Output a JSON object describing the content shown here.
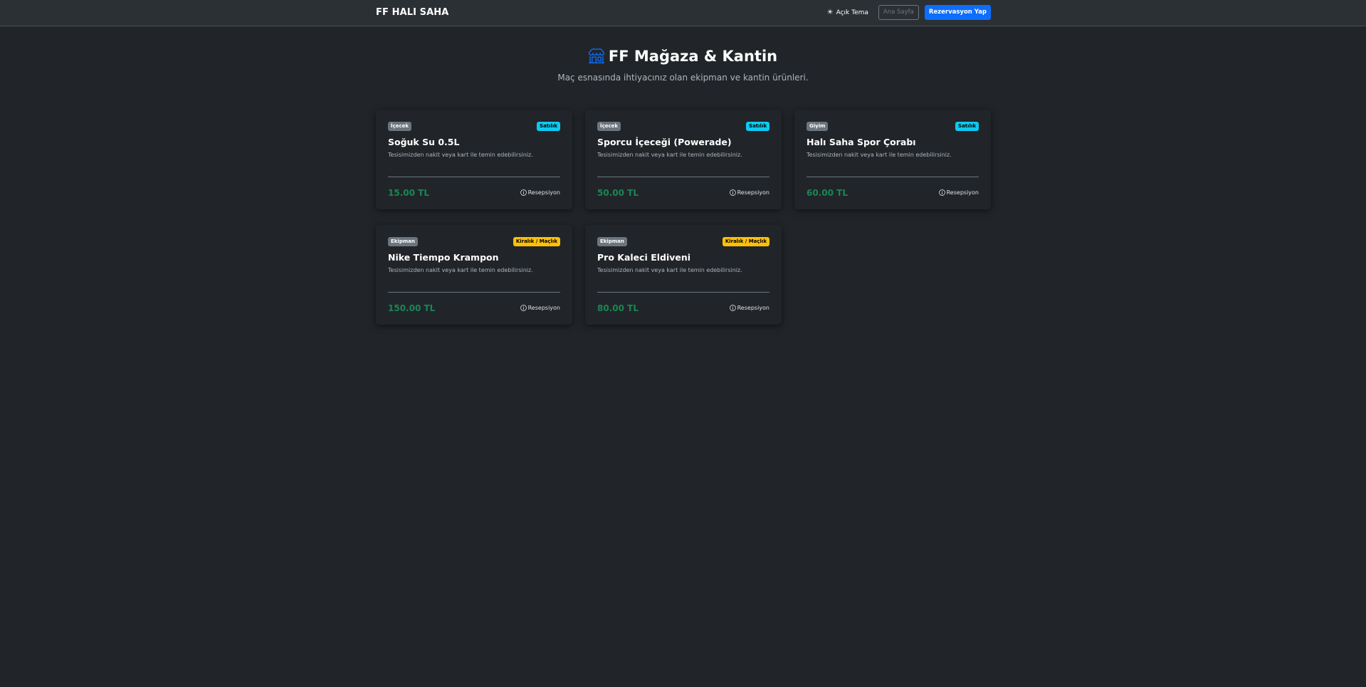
{
  "navbar": {
    "brand": "FF HALI SAHA",
    "theme_toggle_label": "Açık Tema",
    "home_label": "Ana Sayfa",
    "reserve_label": "Rezervasyon Yap"
  },
  "header": {
    "title": "FF Mağaza & Kantin",
    "subtitle": "Maç esnasında ihtiyacınız olan ekipman ve kantin ürünleri."
  },
  "colors": {
    "background": "#212529",
    "navbar": "#2b3035",
    "primary": "#0d6efd",
    "price": "#198754",
    "sale_badge": "#0dcaf0",
    "rent_badge": "#ffc107",
    "category_badge": "#6c757d"
  },
  "products": [
    {
      "category": "İçecek",
      "type": "Satılık",
      "type_kind": "sale",
      "name": "Soğuk Su 0.5L",
      "description": "Tesisimizden nakit veya kart ile temin edebilirsiniz.",
      "price": "15.00 TL",
      "location": "Resepsiyon"
    },
    {
      "category": "İçecek",
      "type": "Satılık",
      "type_kind": "sale",
      "name": "Sporcu İçeceği (Powerade)",
      "description": "Tesisimizden nakit veya kart ile temin edebilirsiniz.",
      "price": "50.00 TL",
      "location": "Resepsiyon"
    },
    {
      "category": "Giyim",
      "type": "Satılık",
      "type_kind": "sale",
      "name": "Halı Saha Spor Çorabı",
      "description": "Tesisimizden nakit veya kart ile temin edebilirsiniz.",
      "price": "60.00 TL",
      "location": "Resepsiyon"
    },
    {
      "category": "Ekipman",
      "type": "Kiralık / Maçlık",
      "type_kind": "rent",
      "name": "Nike Tiempo Krampon",
      "description": "Tesisimizden nakit veya kart ile temin edebilirsiniz.",
      "price": "150.00 TL",
      "location": "Resepsiyon"
    },
    {
      "category": "Ekipman",
      "type": "Kiralık / Maçlık",
      "type_kind": "rent",
      "name": "Pro Kaleci Eldiveni",
      "description": "Tesisimizden nakit veya kart ile temin edebilirsiniz.",
      "price": "80.00 TL",
      "location": "Resepsiyon"
    }
  ]
}
